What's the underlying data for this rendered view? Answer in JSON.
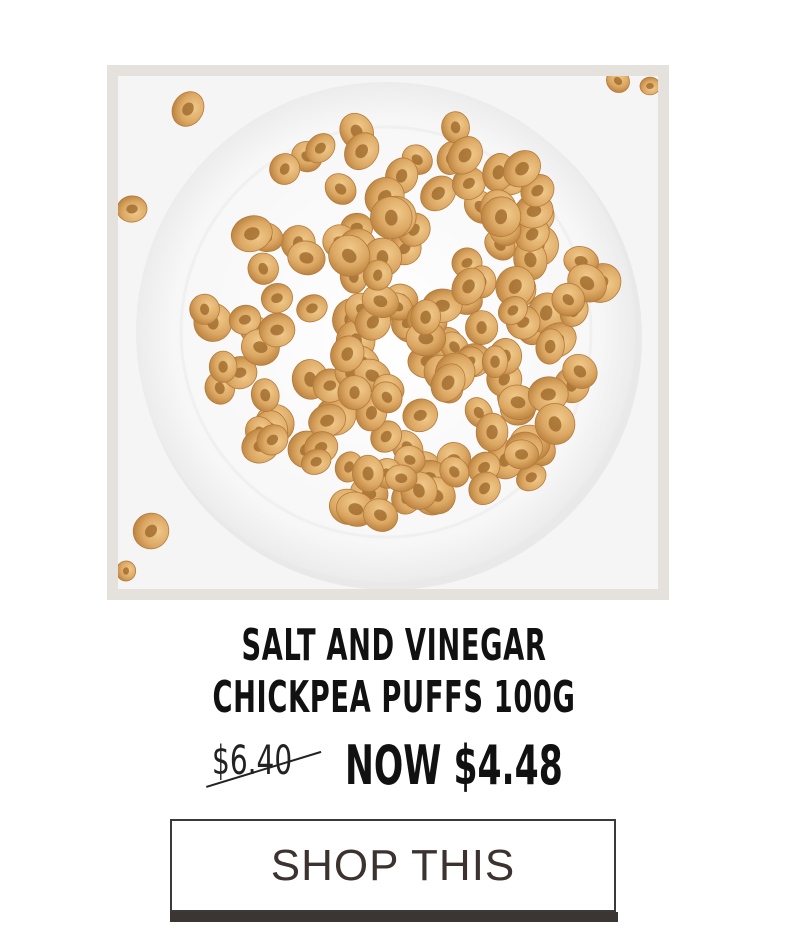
{
  "product": {
    "title_line1": "SALT AND VINEGAR",
    "title_line2": "CHICKPEA PUFFS 100G",
    "old_price": "$6.40",
    "new_price": "NOW $4.48",
    "image_alt_name": "chickpea-puffs-plate-photo"
  },
  "cta": {
    "label": "SHOP THIS"
  },
  "colors": {
    "frame": "#e5e1dc",
    "button_shadow": "#3b3633",
    "text": "#111111",
    "puff": "#d9a85e"
  }
}
